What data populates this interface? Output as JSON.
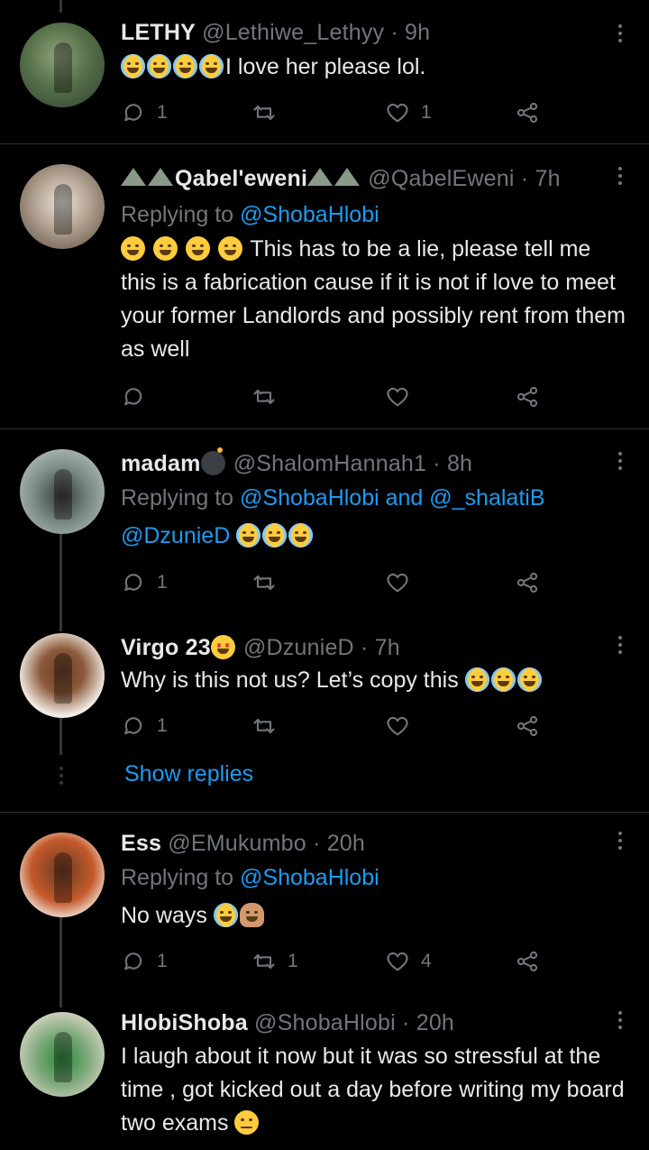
{
  "tweets": [
    {
      "name": "LETHY",
      "handle": "@Lethiwe_Lethyy",
      "time": "· 9h",
      "text": "I love her please lol.",
      "emojis": [
        "laughing-tears-emoji",
        "laughing-tears-emoji",
        "laughing-tears-emoji",
        "laughing-tears-emoji"
      ],
      "replies": "1",
      "retweets": "",
      "likes": "1"
    },
    {
      "name": "Qabel'eweni",
      "handle": "@QabelEweni",
      "time": "· 7h",
      "replying_label": "Replying to",
      "replying_to": "@ShobaHlobi",
      "text": "This has to be a lie, please tell me this is a fabrication cause if it is not if love to meet your former Landlords and possibly rent from them as well",
      "emojis": [
        "rolling-laughing-emoji",
        "rolling-laughing-emoji",
        "rolling-laughing-emoji",
        "rolling-laughing-emoji"
      ],
      "replies": "",
      "retweets": "",
      "likes": ""
    },
    {
      "name": "madam",
      "handle": "@ShalomHannah1",
      "time": "· 8h",
      "replying_label": "Replying to",
      "replying_to": "@ShobaHlobi and @_shalatiB",
      "text_mention": "@DzunieD",
      "emojis": [
        "loudly-crying-emoji",
        "laughing-tears-emoji",
        "laughing-tears-emoji"
      ],
      "replies": "1",
      "retweets": "",
      "likes": ""
    },
    {
      "name": "Virgo 23",
      "handle": "@DzunieD",
      "time": "· 7h",
      "text": "Why is this not us? Let’s copy this",
      "emojis": [
        "laughing-tears-emoji",
        "laughing-tears-emoji",
        "laughing-tears-emoji"
      ],
      "replies": "1",
      "retweets": "",
      "likes": "",
      "show_replies": "Show replies"
    },
    {
      "name": "Ess",
      "handle": "@EMukumbo",
      "time": "· 20h",
      "replying_label": "Replying to",
      "replying_to": "@ShobaHlobi",
      "text": "No ways",
      "emojis": [
        "laughing-tears-emoji",
        "person-facepalming-emoji"
      ],
      "replies": "1",
      "retweets": "1",
      "likes": "4"
    },
    {
      "name": "HlobiShoba",
      "handle": "@ShobaHlobi",
      "time": "· 20h",
      "text": "I laugh about it now but it was so stressful at the time , got kicked out a day before writing my board two exams",
      "emojis": [
        "pensive-face-emoji"
      ]
    }
  ],
  "colors": {
    "background": "#000000",
    "text": "#e7e9ea",
    "muted": "#71767b",
    "link": "#1d9bf0",
    "divider": "#2f3336"
  }
}
